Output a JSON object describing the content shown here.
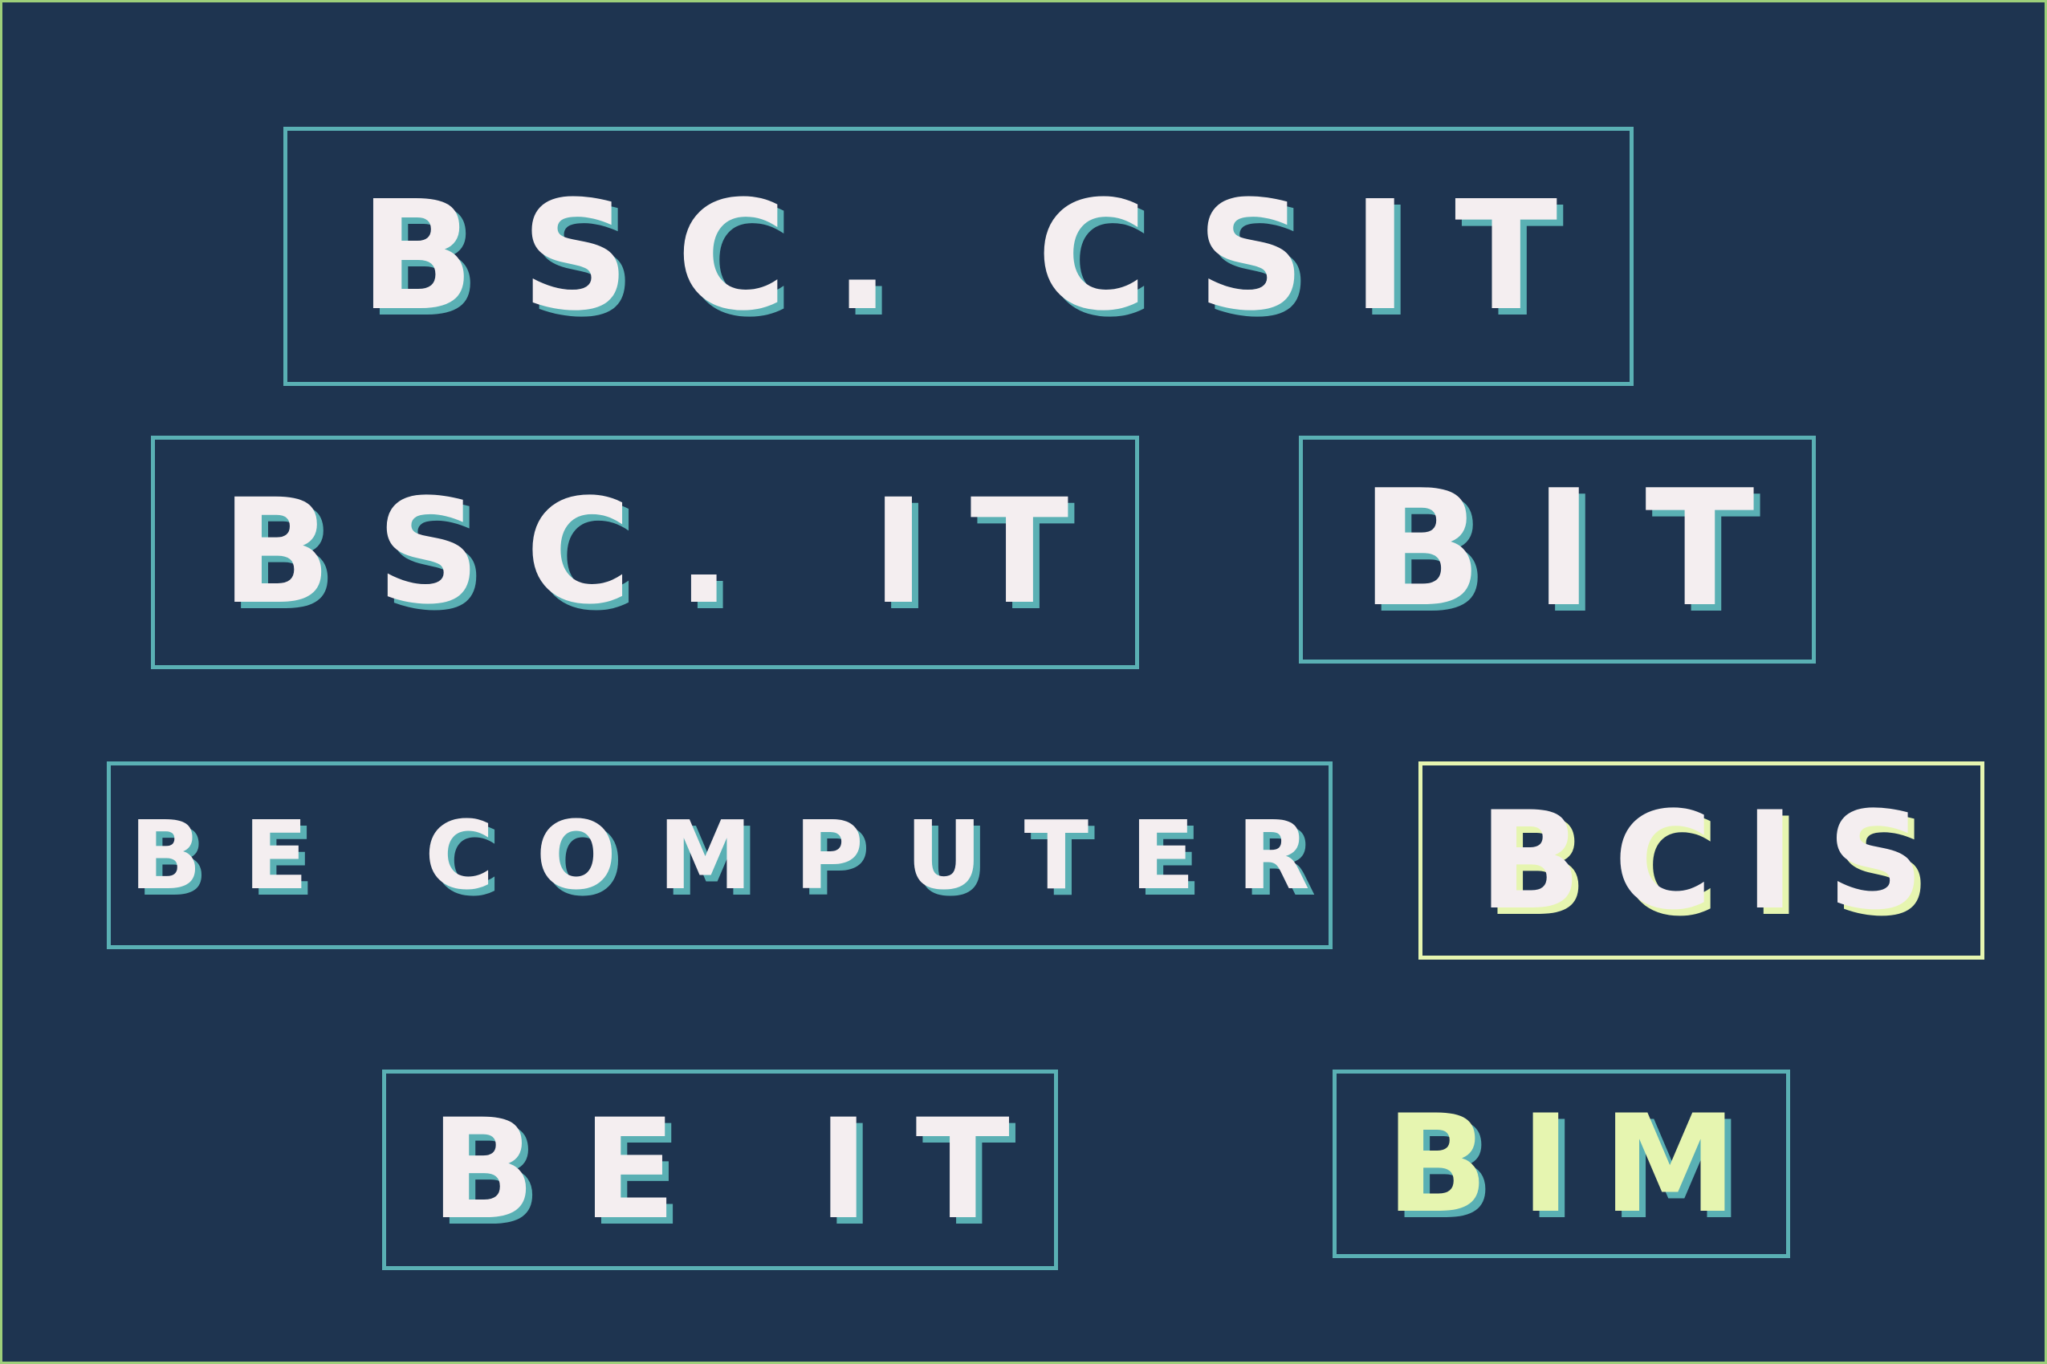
{
  "labels": {
    "bsc_csit": "BSC. CSIT",
    "bsc_it": "BSC. IT",
    "bit": "BIT",
    "be_computer": "BE COMPUTER",
    "bcis": "BCIS",
    "be_it": "BE IT",
    "bim": "BIM"
  },
  "colors": {
    "background": "#1e3450",
    "outer_border": "#9dcf7a",
    "box_border": "#5ab0b4",
    "box_border_highlight": "#e6f5b0",
    "text": "#f4eef0",
    "text_highlight": "#e6f5b0",
    "shadow": "#5ab0b4"
  }
}
